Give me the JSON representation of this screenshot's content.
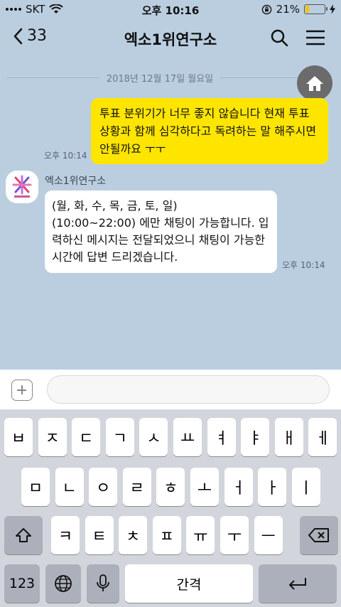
{
  "status": {
    "carrier": "SKT",
    "time": "오후 10:16",
    "battery": "21%",
    "battery_level": 0.21
  },
  "header": {
    "back_count": "33",
    "title": "엑소1위연구소"
  },
  "chat": {
    "date": "2018년 12월 17일 월요일",
    "sent_message": "투표 분위기가 너무 좋지 않습니다 현재 투표 상황과 함께 심각하다고 독려하는 말 해주시면 안될까요 ㅜㅜ",
    "sent_time": "오후 10:14",
    "sender_name": "엑소1위연구소",
    "received_message": "(월, 화, 수, 목, 금, 토, 일)\n(10:00~22:00) 에만 채팅이 가능합니다. 입력하신 메시지는 전달되었으니 채팅이 가능한 시간에 답변 드리겠습니다.",
    "received_time": "오후 10:14"
  },
  "input": {
    "value": ""
  },
  "keyboard": {
    "row1": [
      "ㅂ",
      "ㅈ",
      "ㄷ",
      "ㄱ",
      "ㅅ",
      "ㅛ",
      "ㅕ",
      "ㅑ",
      "ㅐ",
      "ㅔ"
    ],
    "row2": [
      "ㅁ",
      "ㄴ",
      "ㅇ",
      "ㄹ",
      "ㅎ",
      "ㅗ",
      "ㅓ",
      "ㅏ",
      "ㅣ"
    ],
    "row3": [
      "ㅋ",
      "ㅌ",
      "ㅊ",
      "ㅍ",
      "ㅠ",
      "ㅜ",
      "ㅡ"
    ],
    "numbers_label": "123",
    "space_label": "간격"
  }
}
